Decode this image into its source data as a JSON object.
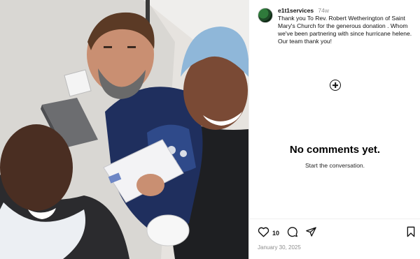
{
  "post": {
    "username": "e1t1services",
    "time_ago": "74w",
    "caption": "Thank you To Rev. Robert Wetherington of Saint Mary's Church for the generous donation . Whom we've been partnering with since hurricane helene. Our team thank you!",
    "like_count": "10",
    "date": "January 30, 2025"
  },
  "comments": {
    "empty_title": "No comments yet.",
    "empty_subtitle": "Start the conversation."
  },
  "icons": {
    "add": "add-circle-icon",
    "like": "heart-icon",
    "comment": "comment-icon",
    "share": "send-icon",
    "save": "bookmark-icon"
  },
  "colors": {
    "muted_text": "#8e8e8e",
    "divider": "#efefef",
    "accent_text": "#000000"
  }
}
